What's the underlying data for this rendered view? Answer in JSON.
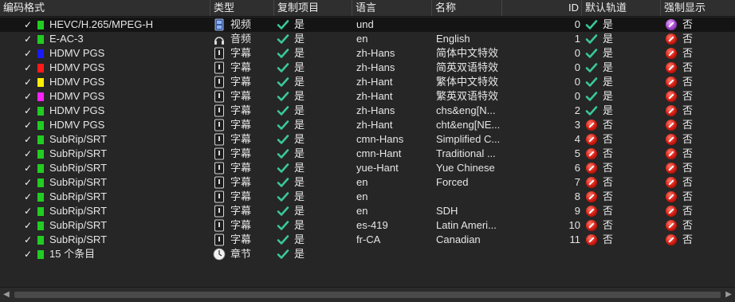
{
  "headers": [
    "编码格式",
    "类型",
    "复制项目",
    "语言",
    "名称",
    "ID",
    "默认轨道",
    "强制显示"
  ],
  "check_mark": "✓",
  "rows": [
    {
      "codec": "HEVC/H.265/MPEG-H",
      "color": "#22cc22",
      "type_icon": "video-icon",
      "type": "视频",
      "copy": "是",
      "lang": "und",
      "name": "",
      "id": "0",
      "def_icon": "ok",
      "def": "是",
      "forced_icon": "no-purple",
      "forced": "否"
    },
    {
      "codec": "E-AC-3",
      "color": "#22cc22",
      "type_icon": "audio-icon",
      "type": "音频",
      "copy": "是",
      "lang": "en",
      "name": "English",
      "id": "1",
      "def_icon": "ok",
      "def": "是",
      "forced_icon": "no",
      "forced": "否"
    },
    {
      "codec": "HDMV PGS",
      "color": "#1a1aff",
      "type_icon": "subtitle-icon",
      "type": "字幕",
      "copy": "是",
      "lang": "zh-Hans",
      "name": "简体中文特效",
      "id": "0",
      "def_icon": "ok",
      "def": "是",
      "forced_icon": "no",
      "forced": "否"
    },
    {
      "codec": "HDMV PGS",
      "color": "#ff1a1a",
      "type_icon": "subtitle-icon",
      "type": "字幕",
      "copy": "是",
      "lang": "zh-Hans",
      "name": "简英双语特效",
      "id": "0",
      "def_icon": "ok",
      "def": "是",
      "forced_icon": "no",
      "forced": "否"
    },
    {
      "codec": "HDMV PGS",
      "color": "#ffee00",
      "type_icon": "subtitle-icon",
      "type": "字幕",
      "copy": "是",
      "lang": "zh-Hant",
      "name": "繁体中文特效",
      "id": "0",
      "def_icon": "ok",
      "def": "是",
      "forced_icon": "no",
      "forced": "否"
    },
    {
      "codec": "HDMV PGS",
      "color": "#ff22ff",
      "type_icon": "subtitle-icon",
      "type": "字幕",
      "copy": "是",
      "lang": "zh-Hant",
      "name": "繁英双语特效",
      "id": "0",
      "def_icon": "ok",
      "def": "是",
      "forced_icon": "no",
      "forced": "否"
    },
    {
      "codec": "HDMV PGS",
      "color": "#22cc22",
      "type_icon": "subtitle-icon",
      "type": "字幕",
      "copy": "是",
      "lang": "zh-Hans",
      "name": "chs&eng[N...",
      "id": "2",
      "def_icon": "ok",
      "def": "是",
      "forced_icon": "no",
      "forced": "否"
    },
    {
      "codec": "HDMV PGS",
      "color": "#22cc22",
      "type_icon": "subtitle-icon",
      "type": "字幕",
      "copy": "是",
      "lang": "zh-Hant",
      "name": "cht&eng[NE...",
      "id": "3",
      "def_icon": "no",
      "def": "否",
      "forced_icon": "no",
      "forced": "否"
    },
    {
      "codec": "SubRip/SRT",
      "color": "#22cc22",
      "type_icon": "subtitle-icon",
      "type": "字幕",
      "copy": "是",
      "lang": "cmn-Hans",
      "name": "Simplified C...",
      "id": "4",
      "def_icon": "no",
      "def": "否",
      "forced_icon": "no",
      "forced": "否"
    },
    {
      "codec": "SubRip/SRT",
      "color": "#22cc22",
      "type_icon": "subtitle-icon",
      "type": "字幕",
      "copy": "是",
      "lang": "cmn-Hant",
      "name": "Traditional ...",
      "id": "5",
      "def_icon": "no",
      "def": "否",
      "forced_icon": "no",
      "forced": "否"
    },
    {
      "codec": "SubRip/SRT",
      "color": "#22cc22",
      "type_icon": "subtitle-icon",
      "type": "字幕",
      "copy": "是",
      "lang": "yue-Hant",
      "name": "Yue Chinese",
      "id": "6",
      "def_icon": "no",
      "def": "否",
      "forced_icon": "no",
      "forced": "否"
    },
    {
      "codec": "SubRip/SRT",
      "color": "#22cc22",
      "type_icon": "subtitle-icon",
      "type": "字幕",
      "copy": "是",
      "lang": "en",
      "name": "Forced",
      "id": "7",
      "def_icon": "no",
      "def": "否",
      "forced_icon": "no",
      "forced": "否"
    },
    {
      "codec": "SubRip/SRT",
      "color": "#22cc22",
      "type_icon": "subtitle-icon",
      "type": "字幕",
      "copy": "是",
      "lang": "en",
      "name": "",
      "id": "8",
      "def_icon": "no",
      "def": "否",
      "forced_icon": "no",
      "forced": "否"
    },
    {
      "codec": "SubRip/SRT",
      "color": "#22cc22",
      "type_icon": "subtitle-icon",
      "type": "字幕",
      "copy": "是",
      "lang": "en",
      "name": "SDH",
      "id": "9",
      "def_icon": "no",
      "def": "否",
      "forced_icon": "no",
      "forced": "否"
    },
    {
      "codec": "SubRip/SRT",
      "color": "#22cc22",
      "type_icon": "subtitle-icon",
      "type": "字幕",
      "copy": "是",
      "lang": "es-419",
      "name": "Latin Ameri...",
      "id": "10",
      "def_icon": "no",
      "def": "否",
      "forced_icon": "no",
      "forced": "否"
    },
    {
      "codec": "SubRip/SRT",
      "color": "#22cc22",
      "type_icon": "subtitle-icon",
      "type": "字幕",
      "copy": "是",
      "lang": "fr-CA",
      "name": "Canadian",
      "id": "11",
      "def_icon": "no",
      "def": "否",
      "forced_icon": "no",
      "forced": "否"
    },
    {
      "codec": "15 个条目",
      "color": "#22cc22",
      "type_icon": "chapter-icon",
      "type": "章节",
      "copy": "是",
      "lang": "",
      "name": "",
      "id": "",
      "def_icon": "",
      "def": "",
      "forced_icon": "",
      "forced": ""
    }
  ],
  "scrollbar": {
    "left_arrow": "◀",
    "right_arrow": "▶"
  }
}
